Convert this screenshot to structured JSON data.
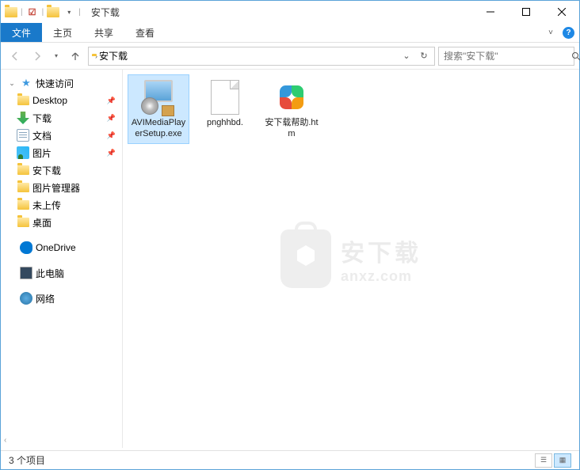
{
  "window": {
    "title": "安下载"
  },
  "ribbon": {
    "file": "文件",
    "tabs": [
      "主页",
      "共享",
      "查看"
    ]
  },
  "breadcrumb": {
    "segments": [
      "安下载"
    ]
  },
  "search": {
    "placeholder": "搜索\"安下载\""
  },
  "sidebar": {
    "quickaccess": "快速访问",
    "items": [
      {
        "label": "Desktop",
        "pinned": true
      },
      {
        "label": "下载",
        "pinned": true
      },
      {
        "label": "文档",
        "pinned": true
      },
      {
        "label": "图片",
        "pinned": true
      },
      {
        "label": "安下载",
        "pinned": false
      },
      {
        "label": "图片管理器",
        "pinned": false
      },
      {
        "label": "未上传",
        "pinned": false
      },
      {
        "label": "桌面",
        "pinned": false
      }
    ],
    "onedrive": "OneDrive",
    "thispc": "此电脑",
    "network": "网络"
  },
  "files": [
    {
      "name": "AVIMediaPlayerSetup.exe",
      "selected": true,
      "type": "exe"
    },
    {
      "name": "pnghhbd.",
      "selected": false,
      "type": "blank"
    },
    {
      "name": "安下载帮助.htm",
      "selected": false,
      "type": "htm"
    }
  ],
  "watermark": {
    "cn": "安下载",
    "en": "anxz.com"
  },
  "status": {
    "text": "3 个项目"
  }
}
